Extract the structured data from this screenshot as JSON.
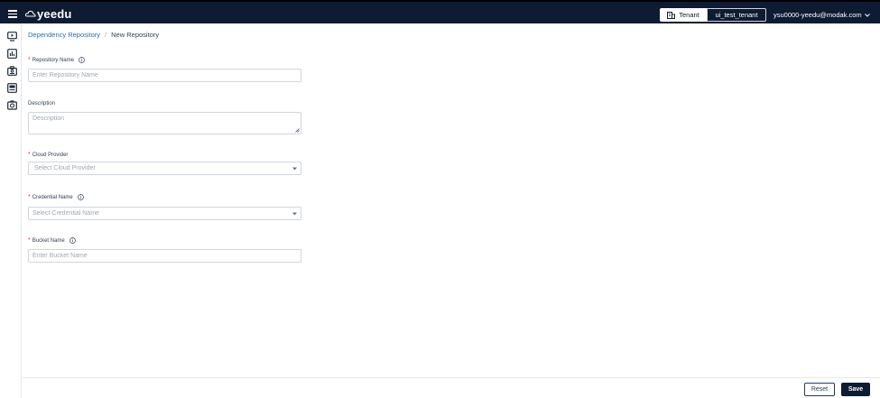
{
  "header": {
    "logo_text": "yeedu",
    "tenant_label": "Tenant",
    "tenant_value": "ui_test_tenant",
    "user_email": "ysu0000-yeedu@modak.com"
  },
  "sidebar": {
    "icons": [
      "monitor-icon",
      "bar-chart-icon",
      "badge-icon",
      "image-gallery-icon",
      "camera-icon"
    ]
  },
  "breadcrumb": {
    "parent": "Dependency Repository",
    "separator": "/",
    "current": "New Repository"
  },
  "form": {
    "repository_name": {
      "label": "Repository Name",
      "placeholder": "Enter Repository Name",
      "required": true,
      "value": ""
    },
    "description": {
      "label": "Description",
      "placeholder": "Description",
      "required": false,
      "value": ""
    },
    "cloud_provider": {
      "label": "Cloud Provider",
      "placeholder": "Select Cloud Provider",
      "required": true
    },
    "credential_name": {
      "label": "Credential Name",
      "placeholder": "Select Credential Name",
      "required": true
    },
    "bucket_name": {
      "label": "Bucket Name",
      "placeholder": "Enter Bucket Name",
      "required": true,
      "value": ""
    }
  },
  "footer": {
    "reset_label": "Reset",
    "save_label": "Save"
  },
  "colors": {
    "header_bg": "#0d1b33",
    "link": "#1f6fb2",
    "required": "#e53935"
  }
}
